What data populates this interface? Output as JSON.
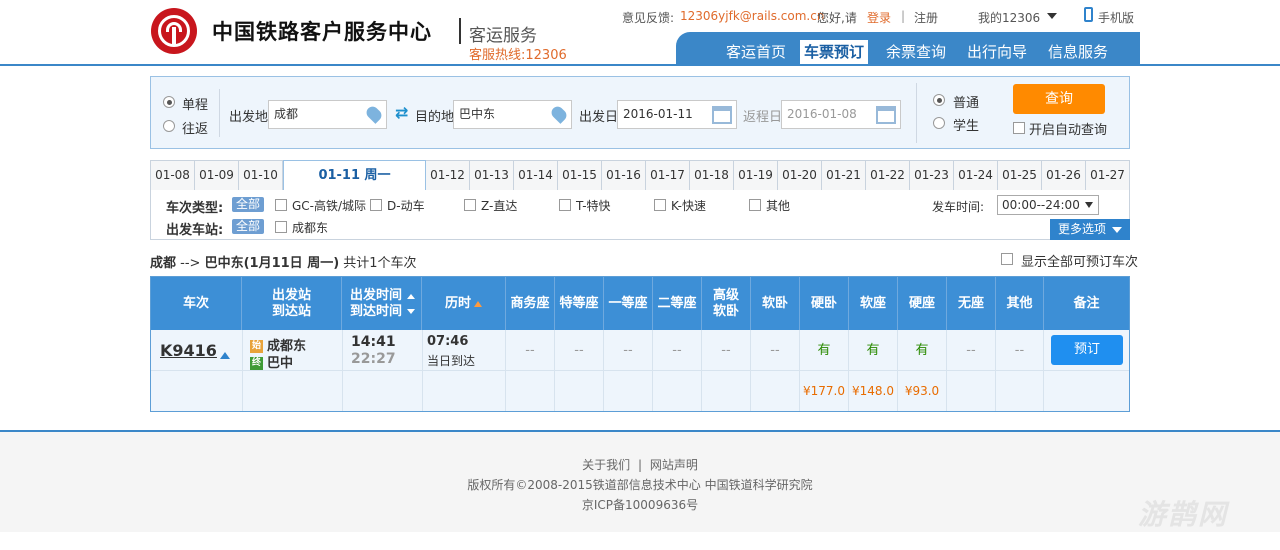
{
  "header": {
    "site_name": "中国铁路客户服务中心",
    "site_sub": "客运服务",
    "hotline": "客服热线:12306",
    "topbar": {
      "feedback_label": "意见反馈:",
      "feedback_email": "12306yjfk@rails.com.cn",
      "greeting": "您好,请",
      "login": "登录",
      "sep": "|",
      "register": "注册",
      "my12306": "我的12306",
      "mobile": "手机版"
    },
    "nav": [
      "客运首页",
      "车票预订",
      "余票查询",
      "出行向导",
      "信息服务"
    ],
    "active_nav": "车票预订"
  },
  "search": {
    "trip_types": [
      "单程",
      "往返"
    ],
    "trip_selected": "单程",
    "from_label": "出发地",
    "from_value": "成都",
    "to_label": "目的地",
    "to_value": "巴中东",
    "depart_label": "出发日",
    "depart_value": "2016-01-11",
    "return_label": "返程日",
    "return_value": "2016-01-08",
    "ticket_types": [
      "普通",
      "学生"
    ],
    "ticket_selected": "普通",
    "query_button": "查询",
    "auto_query": "开启自动查询"
  },
  "dates": [
    "01-08",
    "01-09",
    "01-10",
    "01-11 周一",
    "01-12",
    "01-13",
    "01-14",
    "01-15",
    "01-16",
    "01-17",
    "01-18",
    "01-19",
    "01-20",
    "01-21",
    "01-22",
    "01-23",
    "01-24",
    "01-25",
    "01-26",
    "01-27"
  ],
  "active_date": "01-11 周一",
  "filter": {
    "train_type_label": "车次类型:",
    "all_tag": "全部",
    "train_types": [
      "GC-高铁/城际",
      "D-动车",
      "Z-直达",
      "T-特快",
      "K-快速",
      "其他"
    ],
    "station_label": "出发车站:",
    "stations": [
      "成都东"
    ],
    "time_label": "发车时间:",
    "time_value": "00:00--24:00",
    "more_options": "更多选项"
  },
  "summary": {
    "from": "成都",
    "arrow": "-->",
    "to": "巴中东",
    "date_text": "(1月11日  周一)",
    "count_text": "共计1个车次",
    "show_all": "显示全部可预订车次"
  },
  "table": {
    "headers": [
      "车次",
      "出发站\n到达站",
      "出发时间\n到达时间",
      "历时",
      "商务座",
      "特等座",
      "一等座",
      "二等座",
      "高级\n软卧",
      "软卧",
      "硬卧",
      "软座",
      "硬座",
      "无座",
      "其他",
      "备注"
    ],
    "rows": [
      {
        "train": "K9416",
        "from_badge": "始",
        "from_station": "成都东",
        "to_badge": "终",
        "to_station": "巴中",
        "depart": "14:41",
        "arrive": "22:27",
        "duration": "07:46",
        "arrive_note": "当日到达",
        "seats": [
          "--",
          "--",
          "--",
          "--",
          "--",
          "--",
          "有",
          "有",
          "有",
          "--",
          "--"
        ],
        "prices": [
          "",
          "",
          "",
          "",
          "",
          "",
          "¥177.0",
          "¥148.0",
          "¥93.0",
          "",
          ""
        ],
        "book": "预订"
      }
    ]
  },
  "footer": {
    "about": "关于我们",
    "sep": "|",
    "statement": "网站声明",
    "copyright": "版权所有©2008-2015铁道部信息技术中心   中国铁道科学研究院",
    "icp": "京ICP备10009636号"
  },
  "watermark": "游鹊网",
  "colors": {
    "brand_blue": "#3b87c8",
    "accent_orange": "#ff8a00",
    "logo_red": "#c8161d",
    "available_green": "#2a8a00",
    "price_orange": "#e86c00"
  }
}
